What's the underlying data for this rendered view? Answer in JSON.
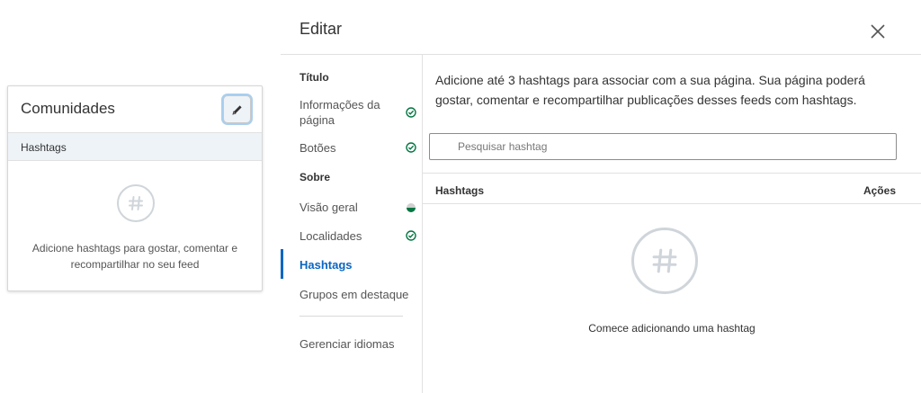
{
  "card": {
    "title": "Comunidades",
    "subheader": "Hashtags",
    "empty_text": "Adicione hashtags para gostar, comentar e recompartilhar no seu feed",
    "edit_icon": "pencil-icon"
  },
  "modal": {
    "title": "Editar",
    "close_icon": "close-icon"
  },
  "nav": {
    "sections": [
      {
        "label": "Título"
      },
      {
        "label": "Sobre"
      }
    ],
    "items": [
      {
        "label": "Informações da página",
        "status": "complete"
      },
      {
        "label": "Botões",
        "status": "complete"
      },
      {
        "label": "Visão geral",
        "status": "partial"
      },
      {
        "label": "Localidades",
        "status": "complete"
      },
      {
        "label": "Hashtags",
        "status": "active"
      },
      {
        "label": "Grupos em destaque",
        "status": "none"
      },
      {
        "label": "Gerenciar idiomas",
        "status": "none"
      }
    ]
  },
  "main": {
    "intro": "Adicione até 3 hashtags para associar com a sua página. Sua página poderá gostar, comentar e recompartilhar publicações desses feeds com hashtags.",
    "search_placeholder": "Pesquisar hashtag",
    "table": {
      "col_name": "Hashtags",
      "col_actions": "Ações"
    },
    "empty_text": "Comece adicionando uma hashtag"
  },
  "colors": {
    "accent": "#0a66c2",
    "success": "#057642",
    "muted_icon": "#cfd5da"
  }
}
